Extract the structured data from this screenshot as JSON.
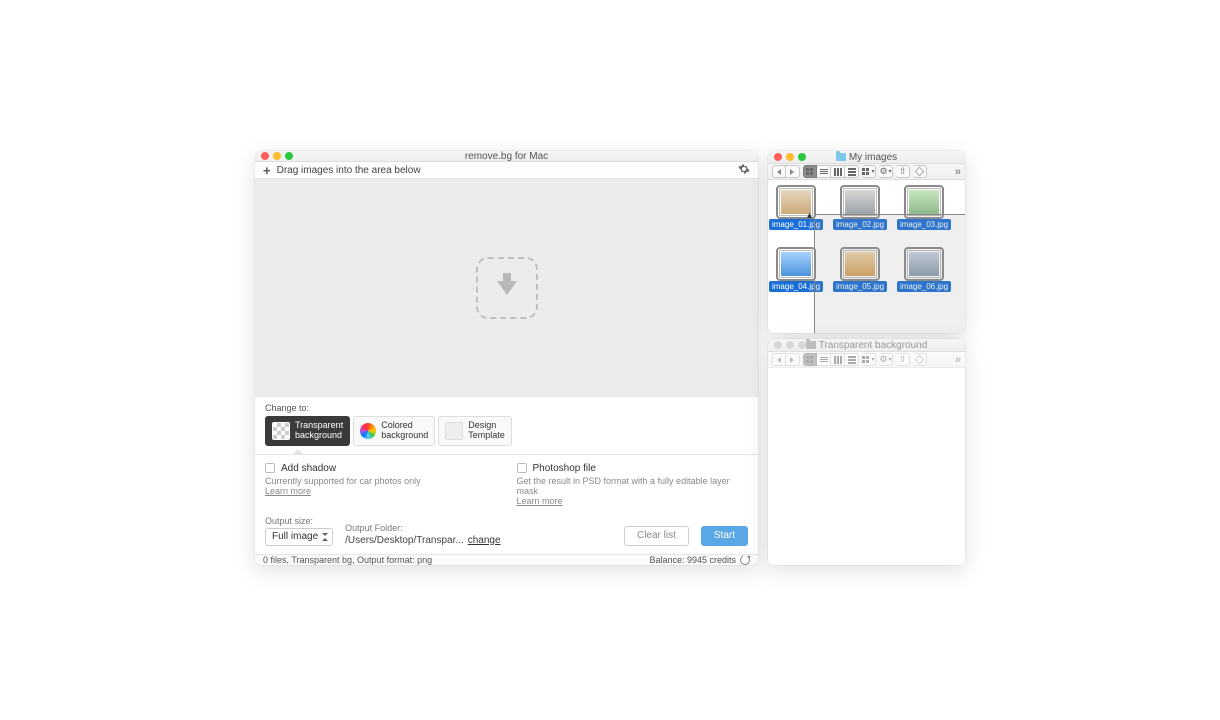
{
  "app": {
    "title": "remove.bg for Mac",
    "drag_hint": "Drag images into the area below",
    "change_to": "Change to:",
    "tabs": {
      "transparent_l1": "Transparent",
      "transparent_l2": "background",
      "colored_l1": "Colored",
      "colored_l2": "background",
      "template_l1": "Design",
      "template_l2": "Template"
    },
    "opt1": {
      "title": "Add shadow",
      "desc": "Currently supported for car photos only",
      "learn": "Learn more"
    },
    "opt2": {
      "title": "Photoshop file",
      "desc": "Get the result in PSD format with a fully editable layer mask",
      "learn": "Learn more"
    },
    "out_size_label": "Output size:",
    "out_size_value": "Full image",
    "out_folder_label": "Output Folder:",
    "out_folder_value": "/Users/Desktop/Transpar...",
    "change_link": "change",
    "clear_btn": "Clear list",
    "start_btn": "Start",
    "status_left": "0 files, Transparent bg, Output format: png",
    "status_right": "Balance: 9945 credits"
  },
  "finder1": {
    "title": "My images",
    "files": [
      "image_01.jpg",
      "image_02.jpg",
      "image_03.jpg",
      "image_04.jpg",
      "image_05.jpg",
      "image_06.jpg"
    ]
  },
  "finder2": {
    "title": "Transparent background"
  }
}
